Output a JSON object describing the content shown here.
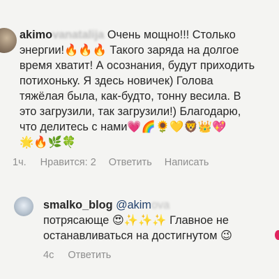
{
  "comments": [
    {
      "username_visible": "akimo",
      "username_blurred": "vanatalija",
      "lines": [
        "Очень мощно!!! Столько",
        "энергии!🔥🔥🔥 Такого заряда на долгое",
        "время хватит! А осознания, будут приходить",
        "потихоньку. Я здесь новичек) Голова",
        "тяжёлая была, как-будто, тонну весила. В",
        "это загрузили, так загрузили!) Благодарю,",
        "что делитесь с нами💗🌈🌻💛🦁👑💖",
        "🌟🔥🌿🍀"
      ],
      "time": "1ч.",
      "likes": "Нравится: 2",
      "reply": "Ответить",
      "message": "Написать"
    },
    {
      "username": "smalko_blog",
      "mention_visible": "@akim",
      "mention_blurred": "ova",
      "lines": [
        "потрясающе 😍✨✨✨ Главное не",
        "останавливаться на достигнутом 😉"
      ],
      "time": "4с",
      "reply": "Ответить"
    }
  ],
  "colors": {
    "background": "#f4f4f2",
    "text": "#262626",
    "meta": "#8e8e8e",
    "mention": "#1f3f6b"
  }
}
